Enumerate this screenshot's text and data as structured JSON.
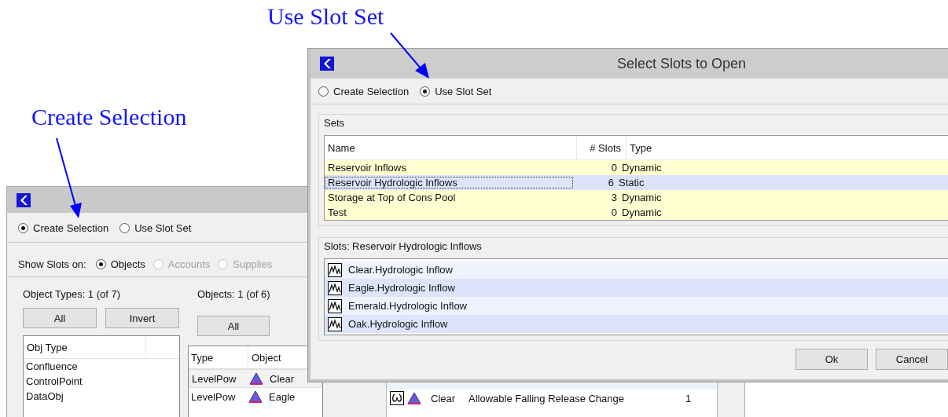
{
  "annotations": [
    {
      "text": "Use Slot Set"
    },
    {
      "text": "Create Selection"
    }
  ],
  "back_window": {
    "mode_options": [
      {
        "label": "Create Selection",
        "selected": true
      },
      {
        "label": "Use Slot Set",
        "selected": false
      }
    ],
    "show_slots_on": {
      "label": "Show Slots on:",
      "options": [
        {
          "label": "Objects",
          "selected": true,
          "disabled": false
        },
        {
          "label": "Accounts",
          "selected": false,
          "disabled": true
        },
        {
          "label": "Supplies",
          "selected": false,
          "disabled": true
        }
      ]
    },
    "object_types": {
      "heading": "Object Types: 1 (of 7)",
      "buttons": [
        "All",
        "Invert"
      ],
      "column": "Obj Type",
      "items": [
        "Confluence",
        "ControlPoint",
        "DataObj"
      ]
    },
    "objects": {
      "heading": "Objects: 1 (of 6)",
      "buttons": [
        "All"
      ],
      "columns": [
        "Type",
        "Object"
      ],
      "rows": [
        {
          "type": "LevelPow",
          "object": "Clear",
          "selected": true
        },
        {
          "type": "LevelPow",
          "object": "Eagle",
          "selected": false
        }
      ]
    },
    "slots": {
      "rows": [
        {
          "object": "Clear",
          "slot": "Allowable Falling Release Change",
          "column_4": "1"
        }
      ]
    }
  },
  "front_window": {
    "title": "Select Slots to Open",
    "mode_options": [
      {
        "label": "Create Selection",
        "selected": false
      },
      {
        "label": "Use Slot Set",
        "selected": true
      }
    ],
    "sets": {
      "label": "Sets",
      "columns": [
        "Name",
        "# Slots",
        "Type"
      ],
      "rows": [
        {
          "name": "Reservoir Inflows",
          "slots": "0",
          "type": "Dynamic",
          "selected": false
        },
        {
          "name": "Reservoir Hydrologic Inflows",
          "slots": "6",
          "type": "Static",
          "selected": true
        },
        {
          "name": "Storage at Top of Cons Pool",
          "slots": "3",
          "type": "Dynamic",
          "selected": false
        },
        {
          "name": "Test",
          "slots": "0",
          "type": "Dynamic",
          "selected": false
        }
      ]
    },
    "slots": {
      "label": "Slots: Reservoir Hydrologic Inflows",
      "items": [
        "Clear.Hydrologic Inflow",
        "Eagle.Hydrologic Inflow",
        "Emerald.Hydrologic Inflow",
        "Oak.Hydrologic Inflow"
      ]
    },
    "buttons": [
      "Ok",
      "Cancel"
    ]
  }
}
